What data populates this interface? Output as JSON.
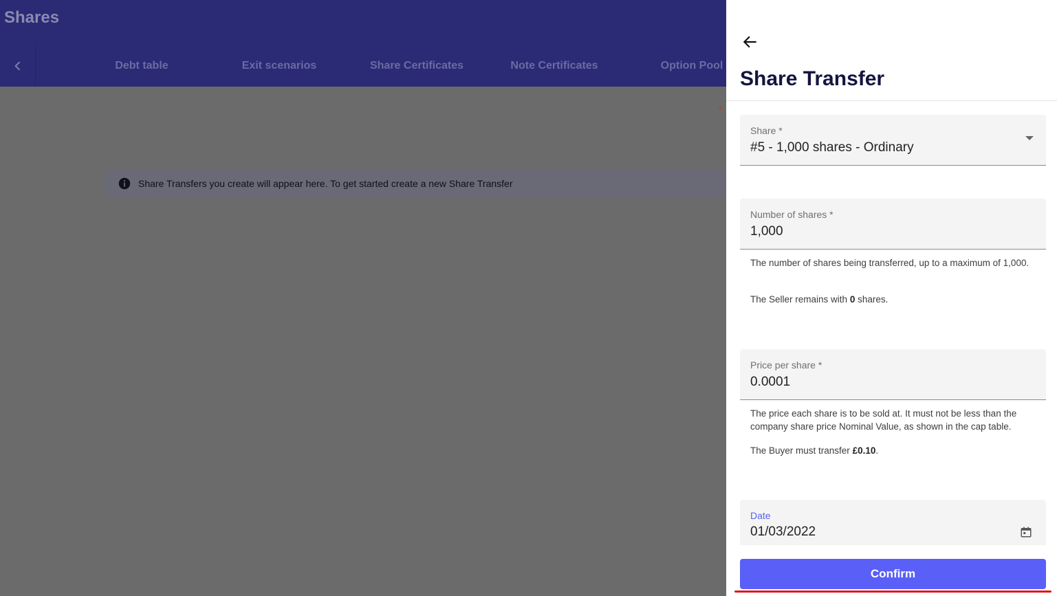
{
  "app": {
    "title": "Shares",
    "tabs": [
      "Debt table",
      "Exit scenarios",
      "Share Certificates",
      "Note Certificates",
      "Option Pool"
    ],
    "info_text": "Share Transfers you create will appear here. To get started create a new Share Transfer"
  },
  "panel": {
    "title": "Share Transfer",
    "share": {
      "label": "Share *",
      "value": "#5 - 1,000 shares - Ordinary"
    },
    "number_of_shares": {
      "label": "Number of shares *",
      "value": "1,000",
      "help_1": "The number of shares being transferred, up to a maximum of 1,000.",
      "help_2_prefix": "The Seller remains with ",
      "help_2_bold": "0",
      "help_2_suffix": " shares."
    },
    "price_per_share": {
      "label": "Price per share *",
      "value": "0.0001",
      "help_1": "The price each share is to be sold at. It must not be less than the company share price Nominal Value, as shown in the cap table.",
      "help_2_prefix": "The Buyer must transfer ",
      "help_2_bold": "£0.10",
      "help_2_suffix": "."
    },
    "date": {
      "label": "Date",
      "value": "01/03/2022"
    },
    "confirm_label": "Confirm"
  },
  "colors": {
    "header_bg": "#2b2a75",
    "overlay_bg": "#6b6b6b",
    "accent": "#5a5ff8",
    "title": "#14153f",
    "highlight_underline": "#e0161e"
  }
}
